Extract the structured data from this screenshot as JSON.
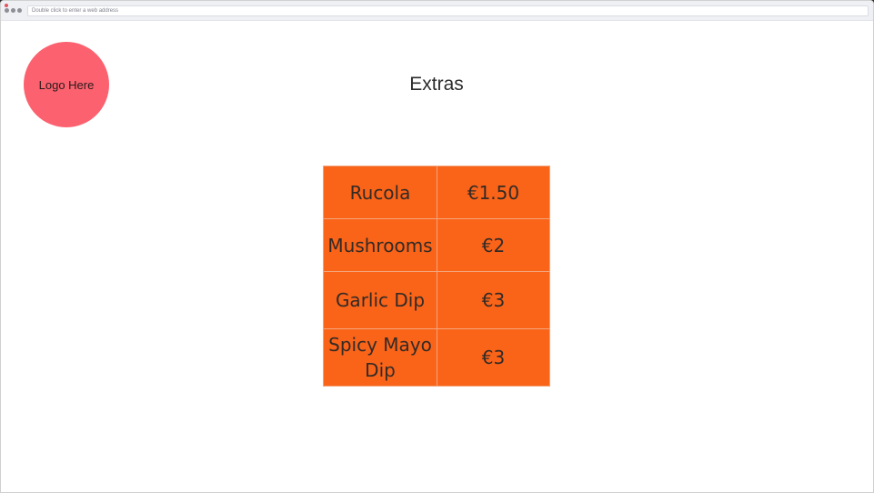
{
  "browser": {
    "address_placeholder": "Double click to enter a web address"
  },
  "logo": {
    "label": "Logo Here"
  },
  "page": {
    "title": "Extras"
  },
  "extras": [
    {
      "name": "Rucola",
      "price": "€1.50"
    },
    {
      "name": "Mushrooms",
      "price": "€2"
    },
    {
      "name": "Garlic Dip",
      "price": "€3"
    },
    {
      "name": "Spicy Mayo Dip",
      "price": "€3"
    }
  ],
  "colors": {
    "logo_bg": "#fc616f",
    "table_bg": "#f96419",
    "table_border": "#f3a57c"
  }
}
